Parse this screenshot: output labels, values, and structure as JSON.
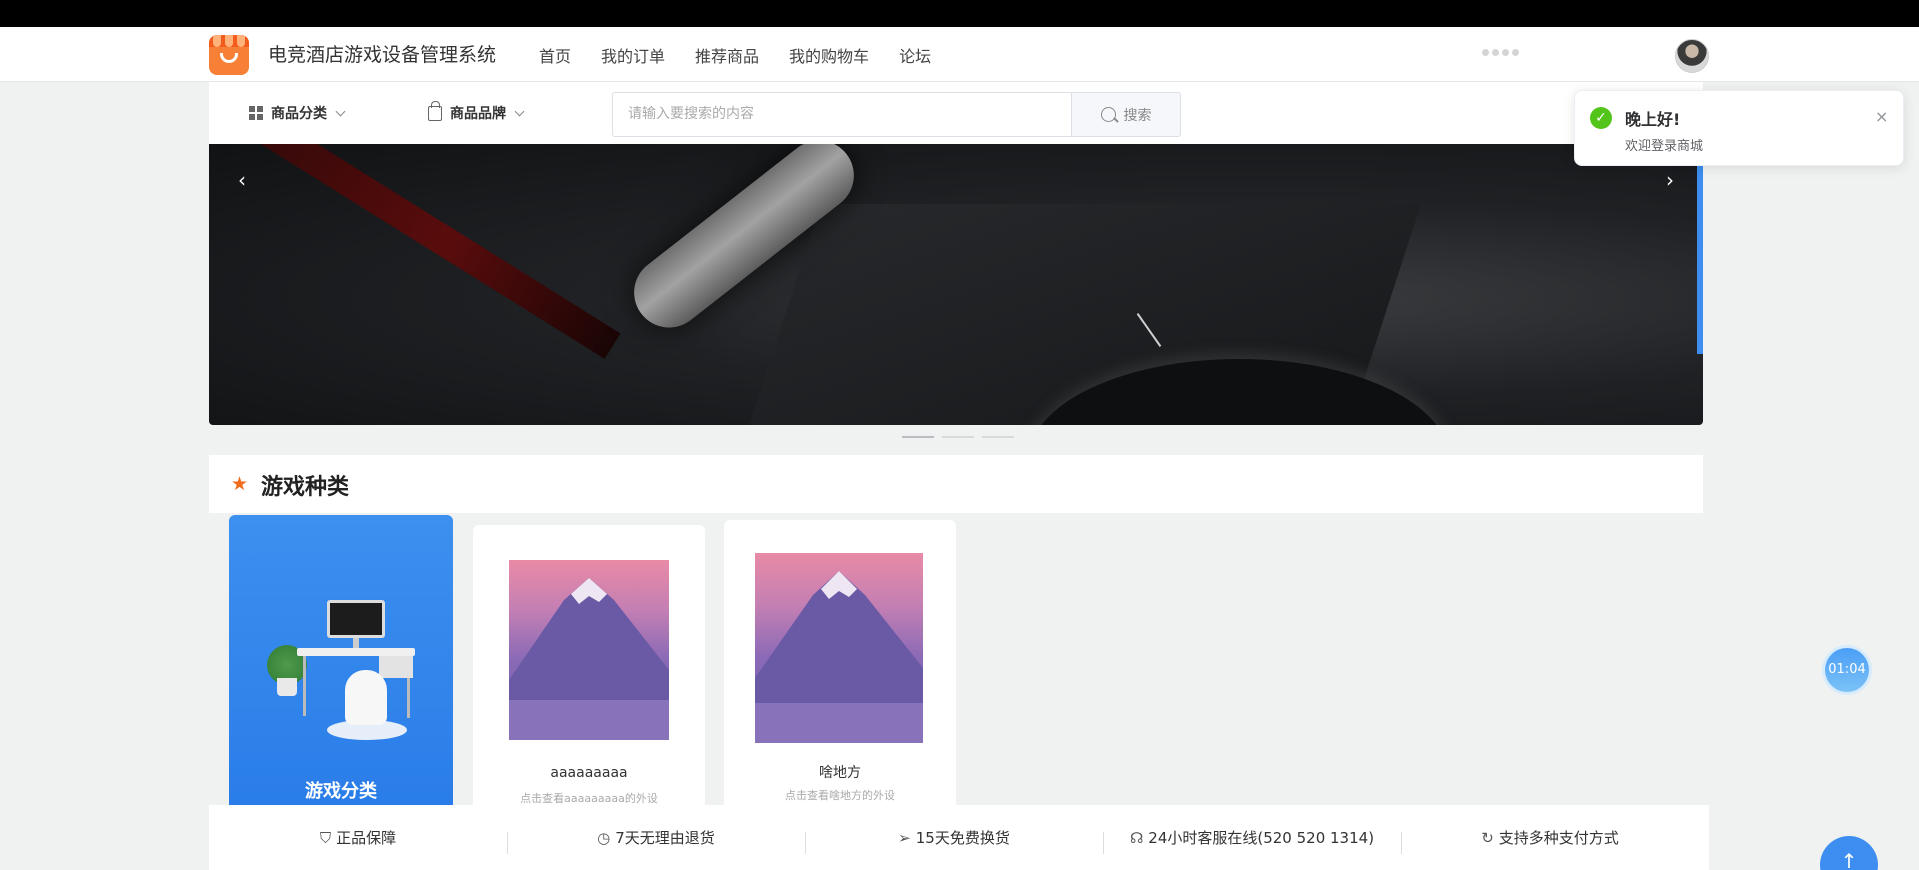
{
  "header": {
    "site_title": "电竞酒店游戏设备管理系统",
    "nav": [
      "首页",
      "我的订单",
      "推荐商品",
      "我的购物车",
      "论坛"
    ]
  },
  "toolbar": {
    "category_label": "商品分类",
    "brand_label": "商品品牌",
    "search_placeholder": "请输入要搜索的内容",
    "search_button": "搜索"
  },
  "banner": {
    "prev": "‹",
    "next": "›"
  },
  "section": {
    "title": "游戏种类",
    "category_card_label": "游戏分类",
    "products": [
      {
        "name": "aaaaaaaaa",
        "desc": "点击查看aaaaaaaaa的外设"
      },
      {
        "name": "啥地方",
        "desc": "点击查看啥地方的外设"
      }
    ]
  },
  "footer": {
    "items": [
      {
        "icon": "medal-icon",
        "label": "正品保障"
      },
      {
        "icon": "clock-icon",
        "label": "7天无理由退货"
      },
      {
        "icon": "send-icon",
        "label": "15天免费换货"
      },
      {
        "icon": "headset-icon",
        "label": "24小时客服在线(520 520 1314)"
      },
      {
        "icon": "refresh-icon",
        "label": "支持多种支付方式"
      }
    ]
  },
  "toast": {
    "title": "晚上好!",
    "message": "欢迎登录商城",
    "close": "×"
  },
  "timer": "01:04",
  "colors": {
    "brand_orange": "#f77f36",
    "accent_blue": "#3d8ef0",
    "success_green": "#52c41a"
  }
}
